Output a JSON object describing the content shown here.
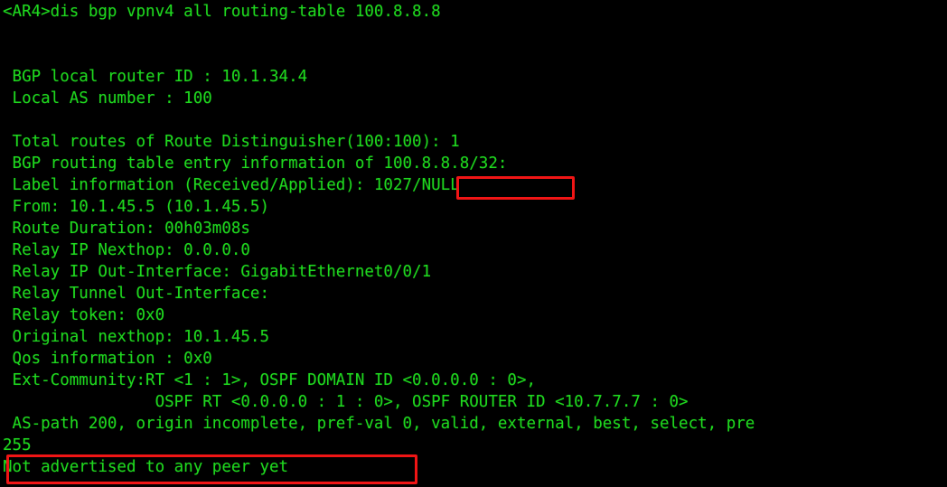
{
  "terminal": {
    "prompt": "<AR4>",
    "command": "dis bgp vpnv4 all routing-table 100.8.8.8",
    "text_color": "#1fd81f",
    "background_color": "#000000",
    "highlight_color": "#f01515",
    "lines": [
      "<AR4>dis bgp vpnv4 all routing-table 100.8.8.8",
      "",
      "",
      " BGP local router ID : 10.1.34.4",
      " Local AS number : 100",
      "",
      " Total routes of Route Distinguisher(100:100): 1",
      " BGP routing table entry information of 100.8.8.8/32:",
      " Label information (Received/Applied): 1027/NULL",
      " From: 10.1.45.5 (10.1.45.5)",
      " Route Duration: 00h03m08s",
      " Relay IP Nexthop: 0.0.0.0",
      " Relay IP Out-Interface: GigabitEthernet0/0/1",
      " Relay Tunnel Out-Interface:",
      " Relay token: 0x0",
      " Original nexthop: 10.1.45.5",
      " Qos information : 0x0",
      " Ext-Community:RT <1 : 1>, OSPF DOMAIN ID <0.0.0.0 : 0>,",
      "                OSPF RT <0.0.0.0 : 1 : 0>, OSPF ROUTER ID <10.7.7.7 : 0>",
      " AS-path 200, origin incomplete, pref-val 0, valid, external, best, select, pre",
      "255",
      "Not advertised to any peer yet"
    ],
    "fields": {
      "bgp_local_router_id_label": "BGP local router ID",
      "bgp_local_router_id_value": "10.1.34.4",
      "local_as_number_label": "Local AS number",
      "local_as_number_value": "100",
      "route_distinguisher": "100:100",
      "total_routes": "1",
      "prefix": "100.8.8.8/32",
      "label_information_label": "Label information (Received/Applied)",
      "label_information_value": "1027/NULL",
      "from": "10.1.45.5 (10.1.45.5)",
      "route_duration": "00h03m08s",
      "relay_ip_nexthop": "0.0.0.0",
      "relay_ip_out_interface": "GigabitEthernet0/0/1",
      "relay_tunnel_out_interface": "",
      "relay_token": "0x0",
      "original_nexthop": "10.1.45.5",
      "qos_information": "0x0",
      "ext_community_rt": "<1 : 1>",
      "ospf_domain_id": "<0.0.0.0 : 0>",
      "ospf_rt": "<0.0.0.0 : 1 : 0>",
      "ospf_router_id": "<10.7.7.7 : 0>",
      "as_path": "200",
      "origin": "incomplete",
      "pref_val": "0",
      "flags": "valid, external, best, select",
      "preference": "255",
      "advertisement_status": "Not advertised to any peer yet"
    },
    "annotations": [
      {
        "name": "label-information-highlight",
        "target_text": "1027/NULL"
      },
      {
        "name": "advertisement-status-highlight",
        "target_text": "Not advertised to any peer yet"
      }
    ]
  }
}
